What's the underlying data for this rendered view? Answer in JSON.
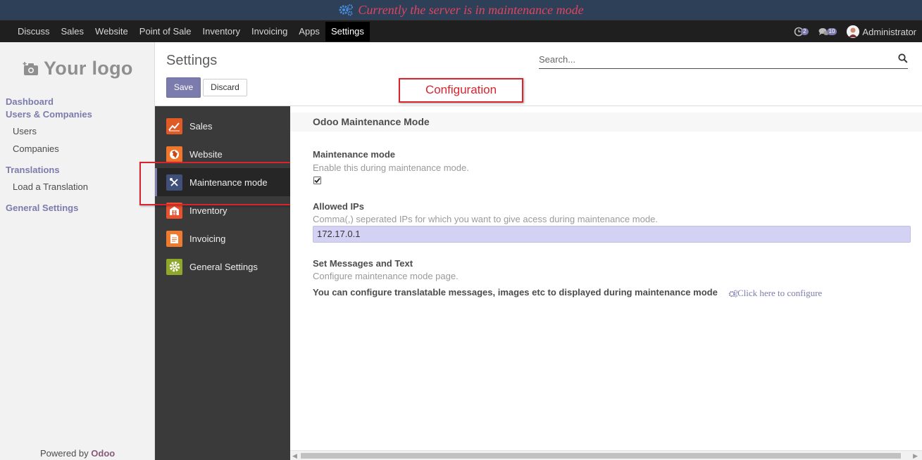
{
  "banner": {
    "icon": "gears-icon",
    "message": "Currently the server is in maintenance mode",
    "message_color": "#e0445e"
  },
  "navbar": {
    "menu": [
      {
        "label": "Discuss",
        "active": false
      },
      {
        "label": "Sales",
        "active": false
      },
      {
        "label": "Website",
        "active": false
      },
      {
        "label": "Point of Sale",
        "active": false
      },
      {
        "label": "Inventory",
        "active": false
      },
      {
        "label": "Invoicing",
        "active": false
      },
      {
        "label": "Apps",
        "active": false
      },
      {
        "label": "Settings",
        "active": true
      }
    ],
    "activity_count": "2",
    "message_count": "10",
    "user_name": "Administrator"
  },
  "app_sidebar": {
    "logo_text": "Your logo",
    "dashboard": "Dashboard",
    "users_companies": "Users & Companies",
    "users": "Users",
    "companies": "Companies",
    "translations": "Translations",
    "load_translation": "Load a Translation",
    "general_settings": "General Settings",
    "powered_by": "Powered by",
    "powered_brand": "Odoo"
  },
  "control_panel": {
    "title": "Settings",
    "save_label": "Save",
    "discard_label": "Discard",
    "search_placeholder": "Search...",
    "annotation": "Configuration"
  },
  "settings_nav": {
    "items": [
      {
        "label": "Sales",
        "icon": "sales-chart-icon",
        "color": "#e05a26"
      },
      {
        "label": "Website",
        "icon": "globe-icon",
        "color": "#f0762c"
      },
      {
        "label": "Maintenance mode",
        "icon": "tools-icon",
        "color": "#41507a",
        "selected": true
      },
      {
        "label": "Inventory",
        "icon": "warehouse-icon",
        "color": "#e8522f"
      },
      {
        "label": "Invoicing",
        "icon": "invoice-icon",
        "color": "#ee7b30"
      },
      {
        "label": "General Settings",
        "icon": "gear-icon",
        "color": "#8fa72b"
      }
    ]
  },
  "content": {
    "section_title": "Odoo Maintenance Mode",
    "maintenance_label": "Maintenance mode",
    "maintenance_help": "Enable this during maintenance mode.",
    "maintenance_checked": true,
    "allowed_ips_label": "Allowed IPs",
    "allowed_ips_help": "Comma(,) seperated IPs for which you want to give acess during maintenance mode.",
    "allowed_ips_value": "172.17.0.1",
    "messages_label": "Set Messages and Text",
    "messages_help": "Configure maintenance mode page.",
    "messages_note": "You can configure translatable messages, images etc to displayed during maintenance mode",
    "configure_link": "Click here to configure"
  },
  "colors": {
    "accent": "#7c7bad",
    "navbar_bg": "#1f1f1f",
    "banner_bg": "#2e4058",
    "annotation_red": "#d9232d"
  }
}
